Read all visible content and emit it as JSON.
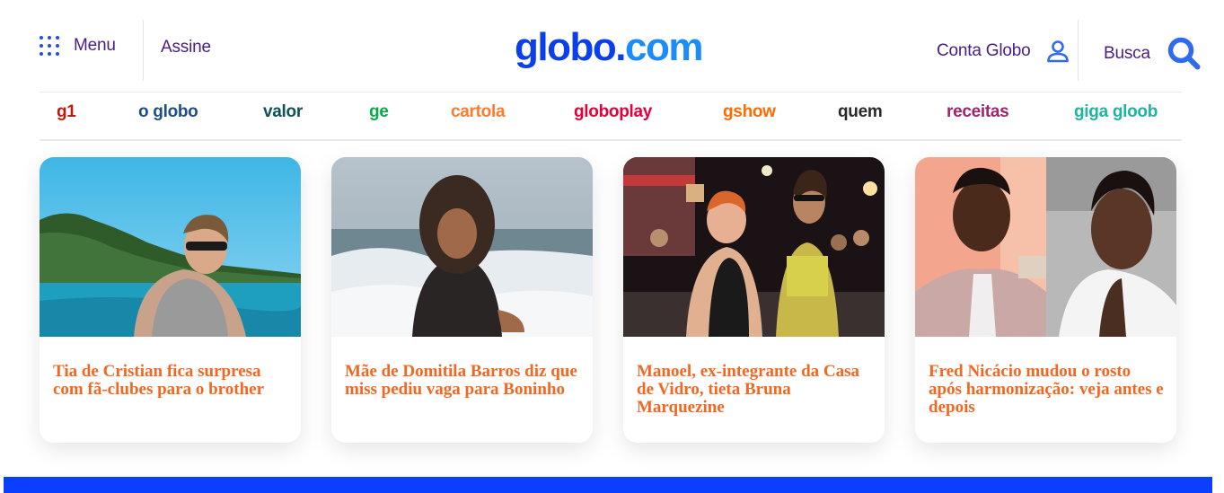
{
  "header": {
    "menu_label": "Menu",
    "assine_label": "Assine",
    "logo": {
      "part1": "globo",
      "dot": ".",
      "part2": "com"
    },
    "account_label": "Conta Globo",
    "search_label": "Busca",
    "icons": {
      "menu": "grid-dots-icon",
      "account": "user-icon",
      "search": "search-icon"
    }
  },
  "nav": {
    "brands": [
      {
        "label": "g1",
        "color": "#c4170c"
      },
      {
        "label": "o globo",
        "color": "#1c4e8c"
      },
      {
        "label": "valor",
        "color": "#0e5258"
      },
      {
        "label": "ge",
        "color": "#06aa48"
      },
      {
        "label": "cartola",
        "color": "#ff7a2b"
      },
      {
        "label": "globoplay",
        "color": "#e6003a"
      },
      {
        "label": "gshow",
        "color": "#ff6b00"
      },
      {
        "label": "quem",
        "color": "#2a2a2a"
      },
      {
        "label": "receitas",
        "color": "#a0236c"
      },
      {
        "label": "giga gloob",
        "color": "#1eb4a0"
      }
    ]
  },
  "cards": [
    {
      "title": "Tia de Cristian fica surpresa com fã-clubes para o brother"
    },
    {
      "title": "Mãe de Domitila Barros diz que miss pediu vaga para Boninho"
    },
    {
      "title": "Manoel, ex-integrante da Casa de Vidro, tieta Bruna Marquezine"
    },
    {
      "title": "Fred Nicácio mudou o rosto após harmonização: veja antes e depois"
    }
  ],
  "colors": {
    "accent": "#0b3fea",
    "headline": "#f26722",
    "header_text": "#4a1d82",
    "footer_bar": "#0b3fff"
  }
}
